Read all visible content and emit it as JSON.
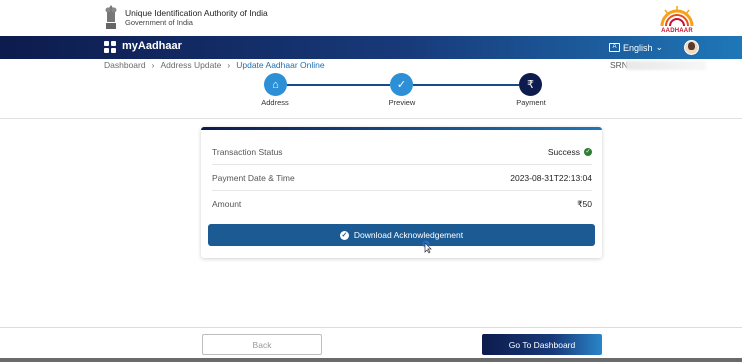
{
  "gov": {
    "org_name": "Unique Identification Authority of India",
    "gov_name": "Government of India",
    "logo_word": "AADHAAR"
  },
  "nav": {
    "brand": "myAadhaar",
    "language": "English"
  },
  "breadcrumb": {
    "items": [
      "Dashboard",
      "Address Update",
      "Update Aadhaar Online"
    ],
    "srn_label": "SRN"
  },
  "stepper": {
    "steps": [
      {
        "label": "Address",
        "icon": "home-icon"
      },
      {
        "label": "Preview",
        "icon": "check-icon"
      },
      {
        "label": "Payment",
        "icon": "rupee-icon"
      }
    ]
  },
  "summary": {
    "rows": [
      {
        "label": "Transaction Status",
        "value": "Success"
      },
      {
        "label": "Payment Date & Time",
        "value": "2023-08-31T22:13:04"
      },
      {
        "label": "Amount",
        "value": "₹50"
      }
    ],
    "download_label": "Download Acknowledgement"
  },
  "footer": {
    "back_label": "Back",
    "dashboard_label": "Go To Dashboard"
  },
  "colors": {
    "navy": "#0d1b4d",
    "blue": "#1f77b8",
    "success": "#2e7d32"
  }
}
